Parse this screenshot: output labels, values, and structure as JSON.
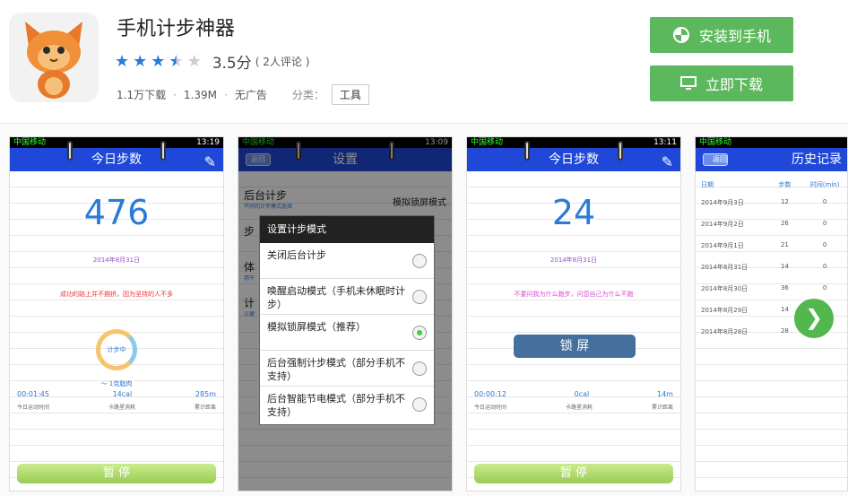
{
  "app": {
    "title": "手机计步神器",
    "rating_stars": 3.5,
    "score": "3.5分",
    "reviews": "( 2人评论 )",
    "downloads": "1.1万下载",
    "size": "1.39M",
    "ads": "无广告",
    "category_label": "分类：",
    "category": "工具"
  },
  "buttons": {
    "install": "安装到手机",
    "download": "立即下载"
  },
  "colors": {
    "accent": "#5cb85c",
    "star": "#2a7ad8",
    "titlebar": "#1f48d8"
  },
  "shot1": {
    "carrier": "中国移动",
    "time": "13:19",
    "title": "今日步数",
    "steps": "476",
    "date": "2014年8月31日",
    "motto": "成功的路上并不拥挤，因为坚持的人不多",
    "circle": "计步中",
    "approx": "～ 1克脂肉",
    "stats": [
      "00:01:45",
      "14cal",
      "285m"
    ],
    "labels": [
      "今日运动时间",
      "卡路里消耗",
      "累计距离"
    ],
    "pause": "暂 停"
  },
  "shot2": {
    "carrier": "中国移动",
    "time": "13:09",
    "back": "返回",
    "title": "设置",
    "row1": "后台计步",
    "row1sub": "不同的计步模式选择",
    "row1val": "模拟锁屏模式",
    "row2": "步",
    "row3": "体",
    "row3sub": "用于",
    "row4": "计",
    "row4sub": "以便",
    "dialog_title": "设置计步模式",
    "options": [
      "关闭后台计步",
      "唤醒启动模式（手机未休眠时计步）",
      "模拟锁屏模式（推荐）",
      "后台强制计步模式（部分手机不支持）",
      "后台智能节电模式（部分手机不支持）"
    ],
    "selected": 2
  },
  "shot3": {
    "carrier": "中国移动",
    "time": "13:11",
    "title": "今日步数",
    "steps": "24",
    "date": "2014年8月31日",
    "motto": "不要问我为什么跑步，问您自己为什么不跑",
    "lock": "锁 屏",
    "stats": [
      "00:00:12",
      "0cal",
      "14m"
    ],
    "labels": [
      "今日运动时间",
      "卡路里消耗",
      "累计距离"
    ],
    "pause": "暂 停"
  },
  "shot4": {
    "carrier": "中国移动",
    "back": "返回",
    "title": "历史记录",
    "headers": [
      "日期",
      "步数",
      "时间(min)"
    ],
    "rows": [
      [
        "2014年9月3日",
        "12",
        "0"
      ],
      [
        "2014年9月2日",
        "26",
        "0"
      ],
      [
        "2014年9月1日",
        "21",
        "0"
      ],
      [
        "2014年8月31日",
        "14",
        "0"
      ],
      [
        "2014年8月30日",
        "36",
        "0"
      ],
      [
        "2014年8月29日",
        "14",
        "0"
      ],
      [
        "2014年8月28日",
        "28",
        "0"
      ]
    ]
  },
  "next_icon": "chevron-right-icon"
}
